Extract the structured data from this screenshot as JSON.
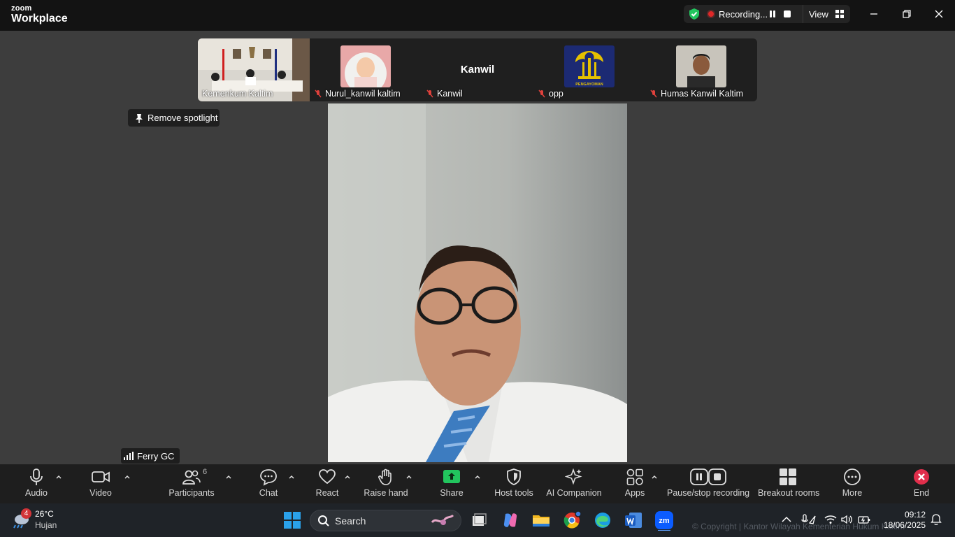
{
  "app": {
    "logo_line1": "zoom",
    "logo_line2": "Workplace"
  },
  "recording": {
    "status": "Recording...",
    "view_label": "View"
  },
  "participants_strip": [
    {
      "name": "Kemenkum Kaltim",
      "muted": false
    },
    {
      "name": "Nurul_kanwil kaltim",
      "muted": true
    },
    {
      "name": "Kanwil",
      "muted": true,
      "display_name": "Kanwil"
    },
    {
      "name": "opp",
      "muted": true,
      "avatar_text": "PENGAYOMAN"
    },
    {
      "name": "Humas Kanwil Kaltim",
      "muted": true
    }
  ],
  "spotlight": {
    "label": "Remove spotlight"
  },
  "main_speaker": {
    "name": "Ferry GC"
  },
  "toolbar": {
    "audio": "Audio",
    "video": "Video",
    "participants": "Participants",
    "participants_count": "6",
    "chat": "Chat",
    "react": "React",
    "raise_hand": "Raise hand",
    "share": "Share",
    "host_tools": "Host tools",
    "ai_companion": "AI Companion",
    "apps": "Apps",
    "pause_stop": "Pause/stop recording",
    "breakout": "Breakout rooms",
    "more": "More",
    "end": "End"
  },
  "taskbar": {
    "weather_temp": "26°C",
    "weather_desc": "Hujan",
    "weather_badge": "4",
    "search_label": "Search",
    "copyright": "© Copyright | Kantor Wilayah Kementerian Hukum Kaltim",
    "time": "09:12",
    "date": "18/06/2025"
  },
  "colors": {
    "accent_green": "#22c55e",
    "end_red": "#e02e4b",
    "rec_red": "#e02828"
  }
}
